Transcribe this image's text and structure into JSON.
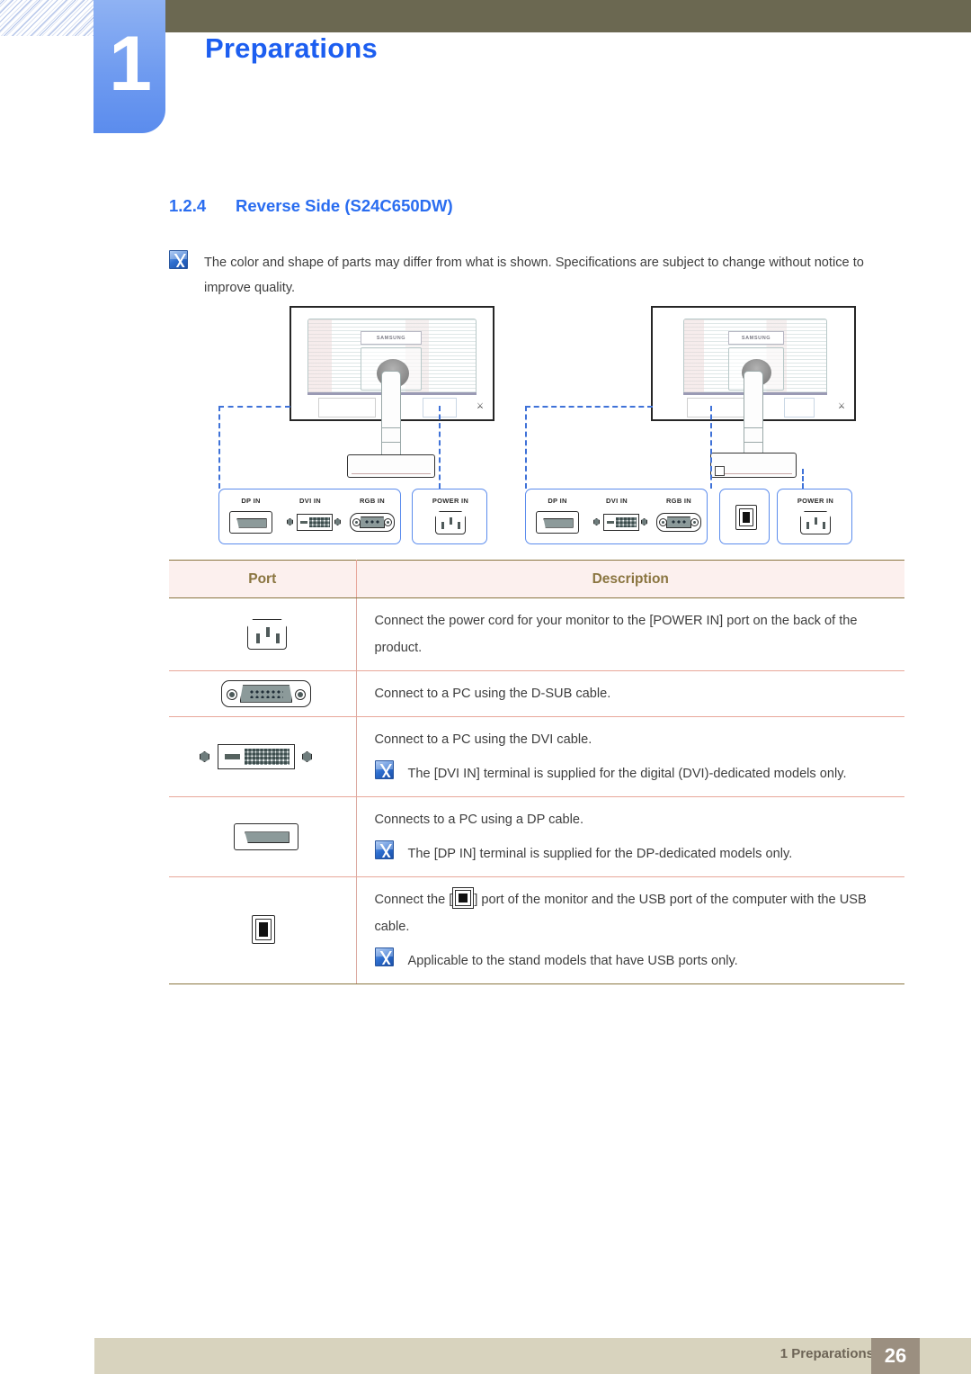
{
  "colors": {
    "header_olive": "#6b6851",
    "chapter_blue": "#6f9bf0",
    "title_blue": "#1c5ef0",
    "heading_blue": "#2a6df0",
    "table_header_bg": "#fcf0ee",
    "table_header_text": "#8a7540",
    "table_border_olive": "#8a7540",
    "table_row_divider": "#e8a79a",
    "footer_bar": "#d8d3be",
    "footer_page_box": "#9b8f80",
    "callout_border": "#5b8ced",
    "dashed_line": "#3f72d8"
  },
  "header": {
    "chapter_number": "1",
    "chapter_title": "Preparations"
  },
  "section": {
    "number": "1.2.4",
    "title": "Reverse Side (S24C650DW)"
  },
  "top_note": {
    "icon": "note-pencil-icon",
    "text": "The color and shape of parts may differ from what is shown. Specifications are subject to change without notice to improve quality."
  },
  "diagrams": {
    "left": {
      "name": "monitor-rear-view-left",
      "logo": "SAMSUNG",
      "callout_groups": [
        {
          "name": "callout-signal-ports",
          "ports": [
            "DP IN",
            "DVI IN",
            "RGB IN"
          ]
        },
        {
          "name": "callout-power-port",
          "ports": [
            "POWER IN"
          ]
        }
      ]
    },
    "right": {
      "name": "monitor-rear-view-right",
      "logo": "SAMSUNG",
      "callout_groups": [
        {
          "name": "callout-signal-ports",
          "ports": [
            "DP IN",
            "DVI IN",
            "RGB IN"
          ]
        },
        {
          "name": "callout-usb-port",
          "ports": [
            ""
          ]
        },
        {
          "name": "callout-power-port",
          "ports": [
            "POWER IN"
          ]
        }
      ]
    }
  },
  "table": {
    "headers": {
      "port": "Port",
      "description": "Description"
    },
    "rows": [
      {
        "port_icon": "power-in-connector-icon",
        "description": "Connect the power cord for your monitor to the [POWER IN] port on the back of the product.",
        "note": null
      },
      {
        "port_icon": "d-sub-vga-connector-icon",
        "description": "Connect to a PC using the D-SUB cable.",
        "note": null
      },
      {
        "port_icon": "dvi-connector-icon",
        "description": "Connect to a PC using the DVI cable.",
        "note": "The [DVI IN] terminal is supplied for the digital (DVI)-dedicated models only."
      },
      {
        "port_icon": "displayport-connector-icon",
        "description": "Connects to a PC using a DP cable.",
        "note": "The [DP IN] terminal is supplied for the DP-dedicated models only."
      },
      {
        "port_icon": "usb-connector-icon",
        "description_before": "Connect the [",
        "description_after": "] port of the monitor and the USB port of the computer with the USB cable.",
        "note": "Applicable to the stand models that have USB ports only."
      }
    ]
  },
  "footer": {
    "label": "1 Preparations",
    "page": "26"
  }
}
